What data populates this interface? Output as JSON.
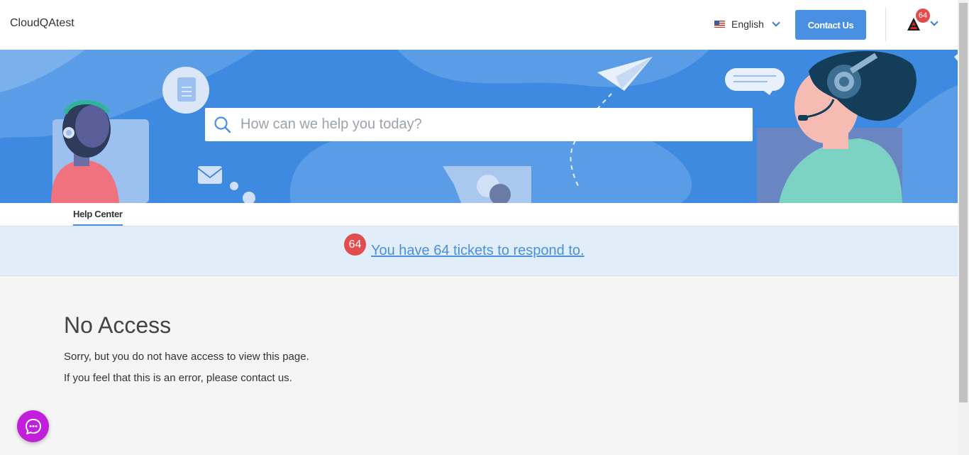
{
  "header": {
    "brand": "CloudQAtest",
    "language": "English",
    "contact_label": "Contact Us",
    "avatar_badge": "64",
    "avatar_letter": "A"
  },
  "hero": {
    "search_placeholder": "How can we help you today?"
  },
  "tabs": [
    {
      "label": "Help Center"
    }
  ],
  "notice": {
    "badge": "64",
    "link_text": "You have 64 tickets to respond to."
  },
  "content": {
    "title": "No Access",
    "line1": "Sorry, but you do not have access to view this page.",
    "line2": "If you feel that this is an error, please contact us."
  },
  "icons": [
    "flag-us-icon",
    "chevron-down-icon",
    "search-icon",
    "chat-icon"
  ],
  "colors": {
    "accent": "#4a90e2",
    "hero_bg": "#3d8ae0",
    "badge_red": "#e24c4c",
    "chat_purple": "#c21fdc",
    "notice_bg": "#e1edf9"
  }
}
